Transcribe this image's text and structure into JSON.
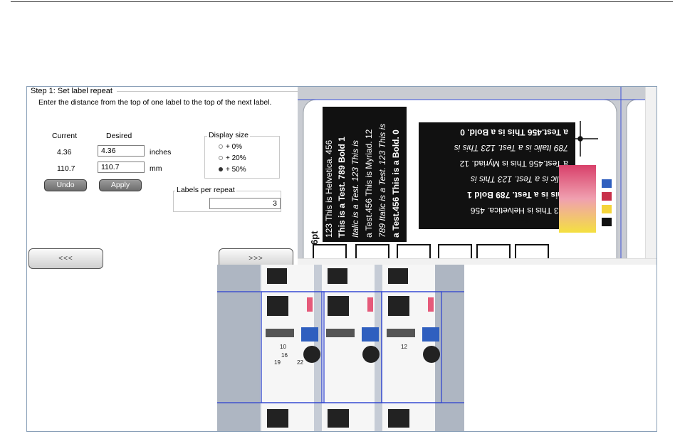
{
  "step": {
    "title": "Step 1: Set label repeat",
    "instructions": "Enter the distance from the top of one label to the top of the next label.",
    "col_current": "Current",
    "col_desired": "Desired",
    "inches": {
      "current": "4.36",
      "desired": "4.36",
      "unit": "inches"
    },
    "mm": {
      "current": "110.7",
      "desired": "110.7",
      "unit": "mm"
    },
    "undo_label": "Undo",
    "apply_label": "Apply"
  },
  "display_size": {
    "legend": "Display size",
    "options": [
      "+ 0%",
      "+ 20%",
      "+ 50%"
    ],
    "selected_index": 2
  },
  "labels_per_repeat": {
    "legend": "Labels per repeat",
    "value": "3"
  },
  "nav": {
    "prev_label": "<<<",
    "next_label": ">>>"
  },
  "zoom_view": {
    "rotated_lines_1": [
      "123 This is Helvetica. 456",
      "This is a Test. 789 Bold 1",
      "Italic is a Test. 123 This is",
      "a Test.456 This is Myriad. 12",
      "789 Italic is a Test. 123 This is",
      "a Test.456 This is a Bold. 0"
    ],
    "rotated_lines_2": [
      "123 This is Helvetica. 456",
      "This is a Test. 789 Bold 1",
      "Italic is a Test. 123 This is",
      "a Test.456 This is Myriad. 12",
      "789 Italic is a Test. 123 This is",
      "a Test.456 This is a Bold. 0"
    ],
    "pt_label": "6pt",
    "colors": {
      "blue": "#2f5fbf",
      "red": "#c8304a",
      "yellow": "#f4d43a",
      "black": "#111111"
    }
  },
  "overview": {
    "numbers": [
      "10",
      "12",
      "16",
      "19",
      "22"
    ]
  }
}
